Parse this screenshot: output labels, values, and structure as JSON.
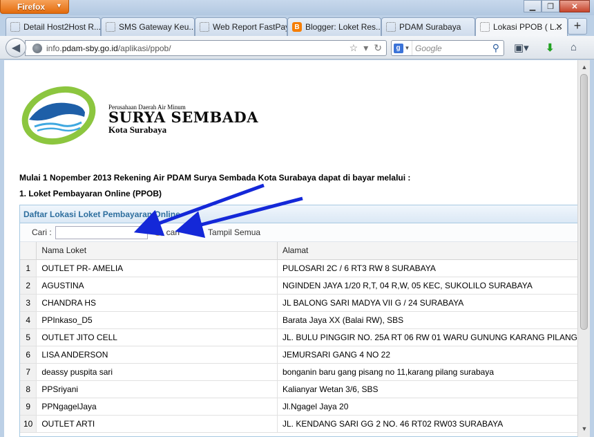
{
  "window": {
    "app_button": "Firefox"
  },
  "tabs": [
    {
      "label": "Detail Host2Host R..."
    },
    {
      "label": "SMS Gateway Keu..."
    },
    {
      "label": "Web Report FastPay"
    },
    {
      "label": "Blogger: Loket Res..."
    },
    {
      "label": "PDAM Surabaya"
    },
    {
      "label": "Lokasi PPOB ( L..."
    }
  ],
  "address": {
    "prefix": "info.",
    "domain": "pdam-sby.go.id",
    "path": "/aplikasi/ppob/"
  },
  "search": {
    "placeholder": "Google"
  },
  "header": {
    "org_small": "Perusahaan Daerah Air Minum",
    "org_name": "SURYA SEMBADA",
    "org_city": "Kota Surabaya"
  },
  "intro_text": "Mulai 1 Nopember 2013 Rekening Air PDAM Surya Sembada Kota Surabaya dapat di bayar melalui :",
  "section_title": "1. Loket Pembayaran Online (PPOB)",
  "grid": {
    "caption": "Daftar Lokasi Loket Pembayaran Online",
    "search_label": "Cari :",
    "search_value": "",
    "search_button": "cari",
    "show_all_button": "Tampil Semua",
    "columns": [
      "",
      "Nama Loket",
      "Alamat"
    ],
    "rows": [
      {
        "no": "1",
        "nama": "OUTLET PR- AMELIA",
        "alamat": "PULOSARI 2C / 6 RT3 RW 8 SURABAYA"
      },
      {
        "no": "2",
        "nama": "AGUSTINA",
        "alamat": "NGINDEN JAYA 1/20 R,T, 04 R,W, 05 KEC, SUKOLILO SURABAYA"
      },
      {
        "no": "3",
        "nama": "CHANDRA HS",
        "alamat": "JL BALONG SARI MADYA VII G / 24 SURABAYA"
      },
      {
        "no": "4",
        "nama": "PPInkaso_D5",
        "alamat": "Barata Jaya XX (Balai RW), SBS"
      },
      {
        "no": "5",
        "nama": "OUTLET JITO CELL",
        "alamat": "JL. BULU PINGGIR NO. 25A RT 06 RW 01 WARU GUNUNG KARANG PILANG"
      },
      {
        "no": "6",
        "nama": "LISA ANDERSON",
        "alamat": "JEMURSARI GANG 4 NO 22"
      },
      {
        "no": "7",
        "nama": "deassy puspita sari",
        "alamat": "bonganin baru gang pisang no 11,karang pilang surabaya"
      },
      {
        "no": "8",
        "nama": "PPSriyani",
        "alamat": "Kalianyar Wetan 3/6, SBS"
      },
      {
        "no": "9",
        "nama": "PPNgagelJaya",
        "alamat": "Jl.Ngagel Jaya 20"
      },
      {
        "no": "10",
        "nama": "OUTLET ARTI",
        "alamat": "JL. KENDANG SARI GG 2 NO. 46 RT02 RW03 SURABAYA"
      }
    ]
  },
  "colors": {
    "firefox_orange": "#e36b0c",
    "grid_header_text": "#2e6e9e",
    "annotation_arrow": "#1428d8"
  }
}
